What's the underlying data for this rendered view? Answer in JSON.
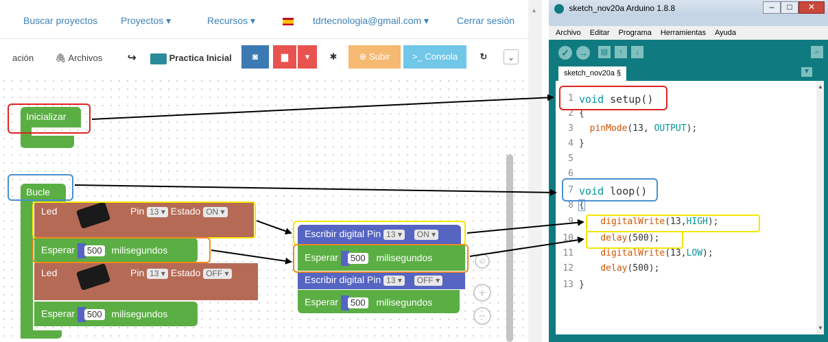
{
  "nav": {
    "search_projects": "Buscar proyectos",
    "projects": "Proyectos ▾",
    "resources": "Recursos ▾",
    "email": "tdrtecnologia@gmail.com ▾",
    "logout": "Cerrar sesión"
  },
  "toolbar": {
    "tab_partial": "ación",
    "files": "Archivos",
    "project_name": "Practica Inicial",
    "upload": "Subir",
    "console": "Consola"
  },
  "blocks": {
    "initialize": "Inicializar",
    "loop": "Bucle",
    "led": "Led",
    "pin": "Pin",
    "pin_value": "13",
    "state": "Estado",
    "state_on": "ON",
    "state_off": "OFF",
    "wait": "Esperar",
    "ms_value": "500",
    "ms_unit": "milisegundos",
    "digital_write": "Escribir digital Pin"
  },
  "ide": {
    "title": "sketch_nov20a Arduino 1.8.8",
    "menu": [
      "Archivo",
      "Editar",
      "Programa",
      "Herramientas",
      "Ayuda"
    ],
    "tab": "sketch_nov20a §",
    "line_numbers": [
      "1",
      "2",
      "3",
      "4",
      "5",
      "6",
      "7",
      "8",
      "9",
      "10",
      "11",
      "12",
      "13"
    ],
    "code": {
      "l1_kw": "void",
      "l1_fn": " setup()",
      "l2": "{",
      "l3_fn": "pinMode",
      "l3_args": "(13, ",
      "l3_const": "OUTPUT",
      "l3_end": ");",
      "l4": "}",
      "l7_kw": "void",
      "l7_fn": " loop()",
      "l8": "{",
      "l9_fn": "digitalWrite",
      "l9_args": "(13,",
      "l9_const": "HIGH",
      "l9_end": ");",
      "l10_fn": "delay",
      "l10_args": "(500);",
      "l11_fn": "digitalWrite",
      "l11_args": "(13,",
      "l11_const": "LOW",
      "l11_end": ");",
      "l12_fn": "delay",
      "l12_args": "(500);",
      "l13": "}"
    }
  },
  "colors": {
    "nav_link": "#3c81b9",
    "block_green": "#5aae43",
    "block_brown": "#b56a55",
    "block_blue": "#5664c2",
    "highlight_red": "#e02020",
    "highlight_blue": "#4a8fd0",
    "highlight_yellow": "#f2e600",
    "highlight_orange": "#f08a1c",
    "ide_teal": "#0f7b80",
    "save_red": "#e8534f",
    "upload_orange": "#f5b971",
    "console_cyan": "#71c7e8"
  }
}
